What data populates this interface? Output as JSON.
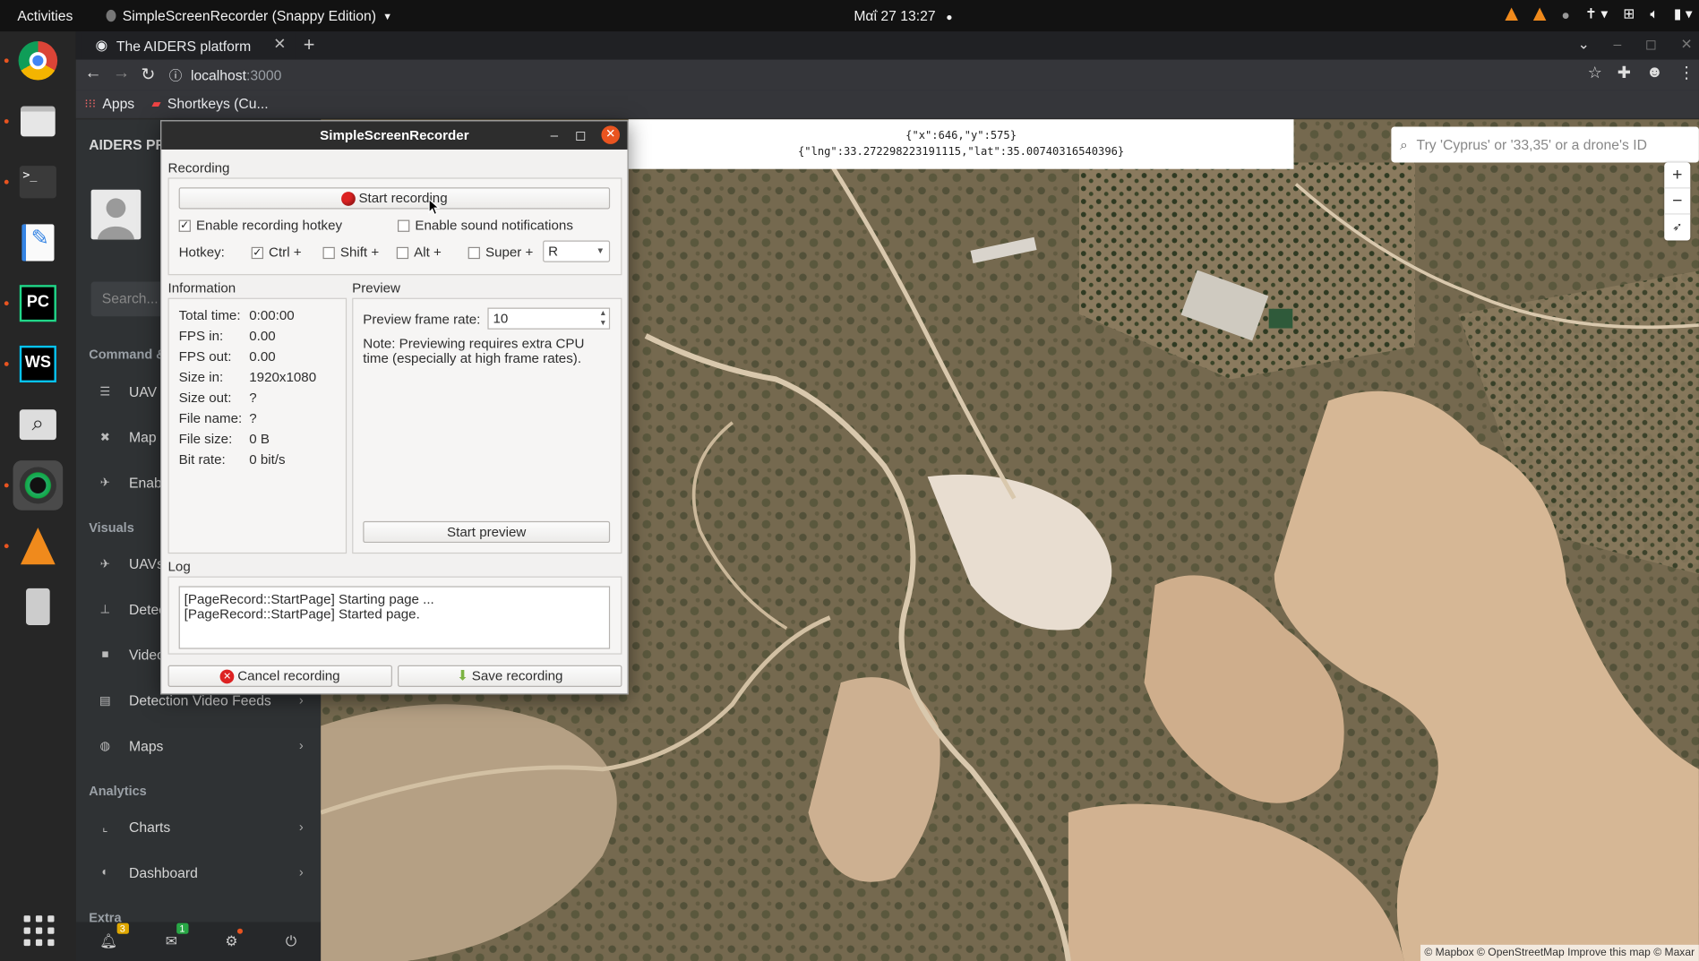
{
  "topbar": {
    "activities": "Activities",
    "app_menu": "SimpleScreenRecorder (Snappy Edition)",
    "clock": "Μαΐ 27  13:27"
  },
  "browser": {
    "tab_title": "The AIDERS platform",
    "url_host": "localhost",
    "url_port": ":3000",
    "bookmarks": [
      "Apps",
      "Shortkeys (Cu..."
    ]
  },
  "sidebar": {
    "title": "AIDERS PR",
    "search_placeholder": "Search...",
    "sections": {
      "command": "Command &",
      "visuals": "Visuals",
      "analytics": "Analytics",
      "extra": "Extra"
    },
    "items": [
      {
        "label": "UAV",
        "icon": "list-icon"
      },
      {
        "label": "Map t",
        "icon": "tools-icon"
      },
      {
        "label": "Enab",
        "icon": "drone-icon"
      },
      {
        "label": "UAVs",
        "icon": "drone-icon"
      },
      {
        "label": "Detec",
        "icon": "detection-icon"
      },
      {
        "label": "Video",
        "icon": "video-icon"
      },
      {
        "label": "Detection Video Feeds",
        "icon": "film-icon"
      },
      {
        "label": "Maps",
        "icon": "globe-icon"
      },
      {
        "label": "Charts",
        "icon": "chart-icon"
      },
      {
        "label": "Dashboard",
        "icon": "dashboard-icon"
      }
    ],
    "bottom": {
      "notifications_count": "3",
      "messages_count": "1"
    }
  },
  "map": {
    "coords_line1": "{\"x\":646,\"y\":575}",
    "coords_line2": "{\"lng\":33.272298223191115,\"lat\":35.00740316540396}",
    "search_placeholder": "Try 'Cyprus' or '33,35' or a drone's ID",
    "zoom_in": "+",
    "zoom_out": "−",
    "attribution": "© Mapbox © OpenStreetMap Improve this map © Maxar"
  },
  "ssr": {
    "title": "SimpleScreenRecorder",
    "recording_label": "Recording",
    "start_recording": "Start recording",
    "enable_hotkey": "Enable recording hotkey",
    "enable_sound": "Enable sound notifications",
    "hotkey_label": "Hotkey:",
    "ctrl": "Ctrl +",
    "shift": "Shift +",
    "alt": "Alt +",
    "super": "Super +",
    "hotkey_key": "R",
    "information_label": "Information",
    "preview_label": "Preview",
    "info": [
      {
        "key": "Total time:",
        "value": "0:00:00"
      },
      {
        "key": "FPS in:",
        "value": "0.00"
      },
      {
        "key": "FPS out:",
        "value": "0.00"
      },
      {
        "key": "Size in:",
        "value": "1920x1080"
      },
      {
        "key": "Size out:",
        "value": "?"
      },
      {
        "key": "File name:",
        "value": "?"
      },
      {
        "key": "File size:",
        "value": "0 B"
      },
      {
        "key": "Bit rate:",
        "value": "0 bit/s"
      }
    ],
    "preview_rate_label": "Preview frame rate:",
    "preview_rate_value": "10",
    "preview_note": "Note: Previewing requires extra CPU time (especially at high frame rates).",
    "start_preview": "Start preview",
    "log_label": "Log",
    "log_line1": "[PageRecord::StartPage] Starting page ...",
    "log_line2": "[PageRecord::StartPage] Started page.",
    "cancel_recording": "Cancel recording",
    "save_recording": "Save recording"
  },
  "colors": {
    "ubuntu_orange": "#e95420",
    "record_red": "#dd2222",
    "sidebar_bg": "#2f3234"
  }
}
